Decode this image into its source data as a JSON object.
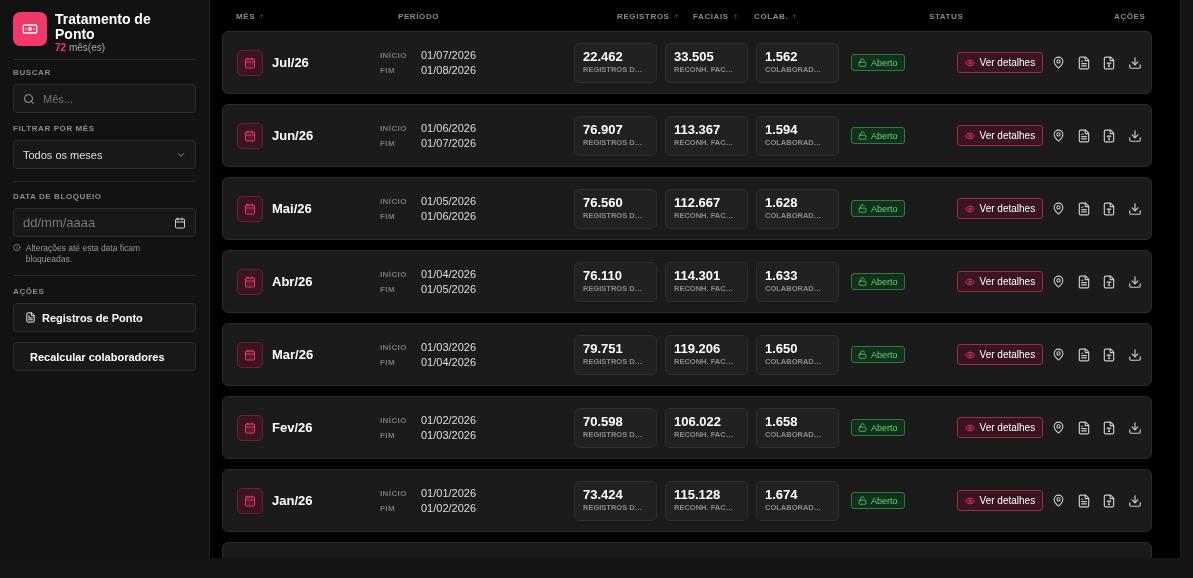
{
  "sidebar": {
    "title": "Tratamento de Ponto",
    "count": "72",
    "count_label": "mês(es)",
    "search": {
      "label": "BUSCAR",
      "placeholder": "Mês..."
    },
    "filter": {
      "label": "FILTRAR POR MÊS",
      "value": "Todos os meses"
    },
    "lock_date": {
      "label": "DATA DE BLOQUEIO",
      "placeholder": "dd/mm/aaaa",
      "hint": "Alterações até esta data ficam bloqueadas."
    },
    "actions": {
      "label": "AÇÕES",
      "buttons": [
        {
          "label": "Registros de Ponto",
          "kind": "icon"
        },
        {
          "label": "Recalcular colaboradores",
          "kind": "plain"
        }
      ]
    }
  },
  "table": {
    "columns": [
      {
        "label": "MÊS",
        "sortable": true
      },
      {
        "label": "PERÍODO",
        "sortable": false
      },
      {
        "label": "REGISTROS",
        "sortable": true
      },
      {
        "label": "FACIAIS",
        "sortable": true
      },
      {
        "label": "COLAB.",
        "sortable": true
      },
      {
        "label": "STATUS",
        "sortable": false
      },
      {
        "label": "AÇÕES",
        "sortable": false
      }
    ],
    "rows": [
      {
        "month": "Jul/26",
        "start_label": "INÍCIO",
        "start": "01/07/2026",
        "end_label": "FIM",
        "end": "01/08/2026",
        "stats": [
          {
            "value": "22.462",
            "label": "REGISTROS D…"
          },
          {
            "value": "33.505",
            "label": "RECONH. FAC…"
          },
          {
            "value": "1.562",
            "label": "COLABORAD…"
          }
        ],
        "status": {
          "label": "Aberto",
          "kind": "open"
        },
        "details_label": "Ver detalhes"
      },
      {
        "month": "Jun/26",
        "start_label": "INÍCIO",
        "start": "01/06/2026",
        "end_label": "FIM",
        "end": "01/07/2026",
        "stats": [
          {
            "value": "76.907",
            "label": "REGISTROS D…"
          },
          {
            "value": "113.367",
            "label": "RECONH. FAC…"
          },
          {
            "value": "1.594",
            "label": "COLABORAD…"
          }
        ],
        "status": {
          "label": "Aberto",
          "kind": "open"
        },
        "details_label": "Ver detalhes"
      },
      {
        "month": "Mai/26",
        "start_label": "INÍCIO",
        "start": "01/05/2026",
        "end_label": "FIM",
        "end": "01/06/2026",
        "stats": [
          {
            "value": "76.560",
            "label": "REGISTROS D…"
          },
          {
            "value": "112.667",
            "label": "RECONH. FAC…"
          },
          {
            "value": "1.628",
            "label": "COLABORAD…"
          }
        ],
        "status": {
          "label": "Aberto",
          "kind": "open"
        },
        "details_label": "Ver detalhes"
      },
      {
        "month": "Abr/26",
        "start_label": "INÍCIO",
        "start": "01/04/2026",
        "end_label": "FIM",
        "end": "01/05/2026",
        "stats": [
          {
            "value": "76.110",
            "label": "REGISTROS D…"
          },
          {
            "value": "114.301",
            "label": "RECONH. FAC…"
          },
          {
            "value": "1.633",
            "label": "COLABORAD…"
          }
        ],
        "status": {
          "label": "Aberto",
          "kind": "open"
        },
        "details_label": "Ver detalhes"
      },
      {
        "month": "Mar/26",
        "start_label": "INÍCIO",
        "start": "01/03/2026",
        "end_label": "FIM",
        "end": "01/04/2026",
        "stats": [
          {
            "value": "79.751",
            "label": "REGISTROS D…"
          },
          {
            "value": "119.206",
            "label": "RECONH. FAC…"
          },
          {
            "value": "1.650",
            "label": "COLABORAD…"
          }
        ],
        "status": {
          "label": "Aberto",
          "kind": "open"
        },
        "details_label": "Ver detalhes"
      },
      {
        "month": "Fev/26",
        "start_label": "INÍCIO",
        "start": "01/02/2026",
        "end_label": "FIM",
        "end": "01/03/2026",
        "stats": [
          {
            "value": "70.598",
            "label": "REGISTROS D…"
          },
          {
            "value": "106.022",
            "label": "RECONH. FAC…"
          },
          {
            "value": "1.658",
            "label": "COLABORAD…"
          }
        ],
        "status": {
          "label": "Aberto",
          "kind": "open"
        },
        "details_label": "Ver detalhes"
      },
      {
        "month": "Jan/26",
        "start_label": "INÍCIO",
        "start": "01/01/2026",
        "end_label": "FIM",
        "end": "01/02/2026",
        "stats": [
          {
            "value": "73.424",
            "label": "REGISTROS D…"
          },
          {
            "value": "115.128",
            "label": "RECONH. FAC…"
          },
          {
            "value": "1.674",
            "label": "COLABORAD…"
          }
        ],
        "status": {
          "label": "Aberto",
          "kind": "open"
        },
        "details_label": "Ver detalhes"
      }
    ]
  }
}
